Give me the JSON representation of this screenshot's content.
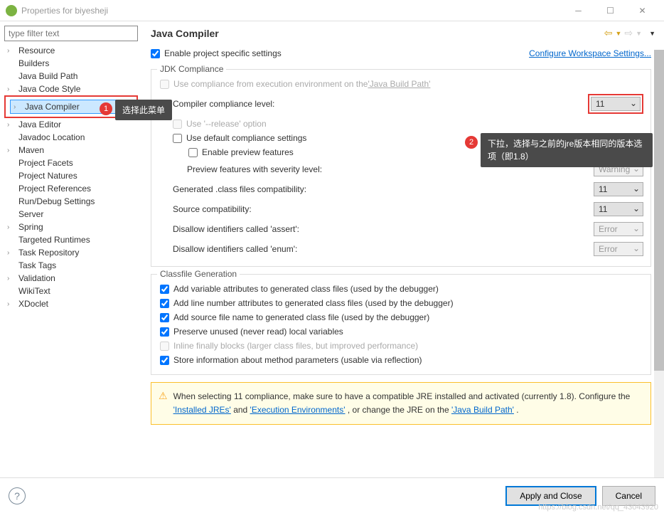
{
  "window": {
    "title": "Properties for biyesheji"
  },
  "filter": {
    "placeholder": "type filter text"
  },
  "tree": {
    "items": [
      {
        "label": "Resource",
        "expandable": true
      },
      {
        "label": "Builders",
        "expandable": false
      },
      {
        "label": "Java Build Path",
        "expandable": false
      },
      {
        "label": "Java Code Style",
        "expandable": true
      },
      {
        "label": "Java Compiler",
        "expandable": true,
        "selected": true,
        "highlight": true
      },
      {
        "label": "Java Editor",
        "expandable": true
      },
      {
        "label": "Javadoc Location",
        "expandable": false
      },
      {
        "label": "Maven",
        "expandable": true
      },
      {
        "label": "Project Facets",
        "expandable": false
      },
      {
        "label": "Project Natures",
        "expandable": false
      },
      {
        "label": "Project References",
        "expandable": false
      },
      {
        "label": "Run/Debug Settings",
        "expandable": false
      },
      {
        "label": "Server",
        "expandable": false
      },
      {
        "label": "Spring",
        "expandable": true
      },
      {
        "label": "Targeted Runtimes",
        "expandable": false
      },
      {
        "label": "Task Repository",
        "expandable": true
      },
      {
        "label": "Task Tags",
        "expandable": false
      },
      {
        "label": "Validation",
        "expandable": true
      },
      {
        "label": "WikiText",
        "expandable": false
      },
      {
        "label": "XDoclet",
        "expandable": true
      }
    ]
  },
  "page": {
    "title": "Java Compiler",
    "enable_project_label": "Enable project specific settings",
    "configure_link": "Configure Workspace Settings..."
  },
  "jdk": {
    "group_title": "JDK Compliance",
    "use_exec_env": "Use compliance from execution environment on the ",
    "build_path_link": "'Java Build Path'",
    "compliance_label": "Compiler compliance level:",
    "compliance_value": "11",
    "use_release": "Use '--release' option",
    "use_default": "Use default compliance settings",
    "enable_preview": "Enable preview features",
    "preview_severity": "Preview features with severity level:",
    "preview_value": "Warning",
    "generated_class": "Generated .class files compatibility:",
    "generated_class_value": "11",
    "source_compat": "Source compatibility:",
    "source_compat_value": "11",
    "disallow_assert": "Disallow identifiers called 'assert':",
    "disallow_assert_value": "Error",
    "disallow_enum": "Disallow identifiers called 'enum':",
    "disallow_enum_value": "Error"
  },
  "classfile": {
    "group_title": "Classfile Generation",
    "add_var": "Add variable attributes to generated class files (used by the debugger)",
    "add_line": "Add line number attributes to generated class files (used by the debugger)",
    "add_source": "Add source file name to generated class file (used by the debugger)",
    "preserve": "Preserve unused (never read) local variables",
    "inline": "Inline finally blocks (larger class files, but improved performance)",
    "store_info": "Store information about method parameters (usable via reflection)"
  },
  "warning": {
    "text1": "When selecting 11 compliance, make sure to have a compatible JRE installed and activated (currently 1.8). Configure the ",
    "link1": "'Installed JREs'",
    "text2": " and ",
    "link2": "'Execution Environments'",
    "text3": ", or change the JRE on the ",
    "link3": "'Java Build Path'",
    "text4": "."
  },
  "footer": {
    "apply": "Apply and Close",
    "cancel": "Cancel"
  },
  "annotations": {
    "badge1": "1",
    "text1": "选择此菜单",
    "badge2": "2",
    "text2": "下拉，选择与之前的jre版本相同的版本选项（即1.8）"
  },
  "watermark": "https://blog.csdn.net/qq_43043920"
}
